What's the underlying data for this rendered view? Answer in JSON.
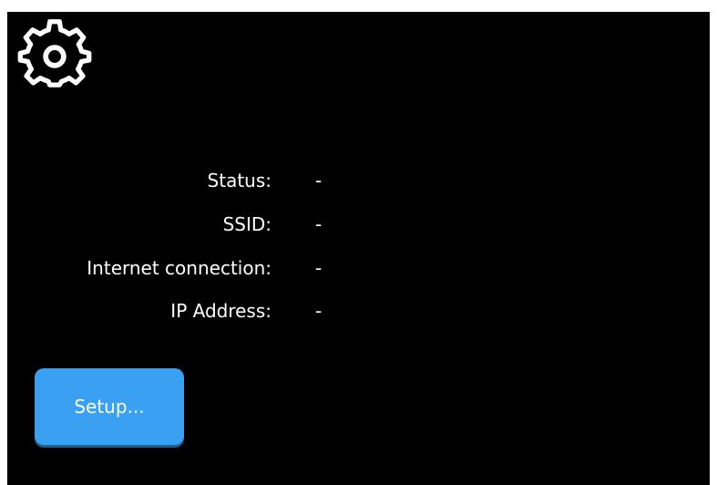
{
  "toolbar": {
    "settings_icon": "gear-icon"
  },
  "network_info": {
    "rows": [
      {
        "label": "Status:",
        "value": "-"
      },
      {
        "label": "SSID:",
        "value": "-"
      },
      {
        "label": "Internet connection:",
        "value": "-"
      },
      {
        "label": "IP Address:",
        "value": "-"
      }
    ]
  },
  "actions": {
    "setup_label": "Setup..."
  },
  "colors": {
    "background": "#000000",
    "text": "#ffffff",
    "button": "#3aa1f2"
  }
}
